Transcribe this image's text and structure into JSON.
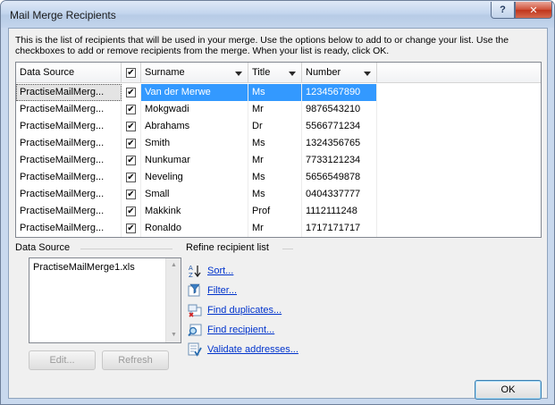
{
  "window": {
    "title": "Mail Merge Recipients",
    "help_label": "?",
    "close_label": "✕"
  },
  "intro_text": "This is the list of recipients that will be used in your merge.  Use the options below to add to or change your list.  Use the checkboxes to add or remove recipients from the merge.  When your list is ready, click OK.",
  "table": {
    "columns": [
      "Data Source",
      "✔",
      "Surname",
      "Title",
      "Number"
    ],
    "rows": [
      {
        "source": "PractiseMailMerg...",
        "checked": "✔",
        "surname": "Van der Merwe",
        "title": "Ms",
        "number": "1234567890"
      },
      {
        "source": "PractiseMailMerg...",
        "checked": "✔",
        "surname": "Mokgwadi",
        "title": "Mr",
        "number": "9876543210"
      },
      {
        "source": "PractiseMailMerg...",
        "checked": "✔",
        "surname": "Abrahams",
        "title": "Dr",
        "number": "5566771234"
      },
      {
        "source": "PractiseMailMerg...",
        "checked": "✔",
        "surname": "Smith",
        "title": "Ms",
        "number": "1324356765"
      },
      {
        "source": "PractiseMailMerg...",
        "checked": "✔",
        "surname": "Nunkumar",
        "title": "Mr",
        "number": "7733121234"
      },
      {
        "source": "PractiseMailMerg...",
        "checked": "✔",
        "surname": "Neveling",
        "title": "Ms",
        "number": "5656549878"
      },
      {
        "source": "PractiseMailMerg...",
        "checked": "✔",
        "surname": "Small",
        "title": "Ms",
        "number": "0404337777"
      },
      {
        "source": "PractiseMailMerg...",
        "checked": "✔",
        "surname": "Makkink",
        "title": "Prof",
        "number": "1112111248"
      },
      {
        "source": "PractiseMailMerg...",
        "checked": "✔",
        "surname": "Ronaldo",
        "title": "Mr",
        "number": "1717171717"
      }
    ]
  },
  "data_source": {
    "label": "Data Source",
    "files": [
      "PractiseMailMerge1.xls"
    ],
    "edit_label": "Edit...",
    "refresh_label": "Refresh"
  },
  "refine": {
    "label": "Refine recipient list",
    "items": [
      {
        "label": "Sort...",
        "icon": "sort-az-icon"
      },
      {
        "label": "Filter...",
        "icon": "filter-icon"
      },
      {
        "label": "Find duplicates...",
        "icon": "find-duplicates-icon"
      },
      {
        "label": "Find recipient...",
        "icon": "find-recipient-icon"
      },
      {
        "label": "Validate addresses...",
        "icon": "validate-addresses-icon"
      }
    ]
  },
  "ok_label": "OK",
  "colors": {
    "selection": "#3399ff",
    "link": "#0033cc",
    "close_button": "#c0351c"
  }
}
